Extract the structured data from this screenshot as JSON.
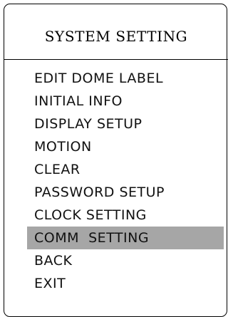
{
  "menu": {
    "title": "SYSTEM SETTING",
    "items": [
      {
        "label": "EDIT DOME LABEL"
      },
      {
        "label": "INITIAL INFO"
      },
      {
        "label": "DISPLAY SETUP"
      },
      {
        "label": "MOTION"
      },
      {
        "label": "CLEAR"
      },
      {
        "label": "PASSWORD SETUP"
      },
      {
        "label": "CLOCK SETTING"
      },
      {
        "label": "COMM  SETTING"
      },
      {
        "label": "BACK"
      },
      {
        "label": "EXIT"
      }
    ],
    "selected_index": 7,
    "colors": {
      "border": "#000000",
      "background": "#ffffff",
      "highlight": "#a6a6a6",
      "text": "#111111"
    }
  }
}
